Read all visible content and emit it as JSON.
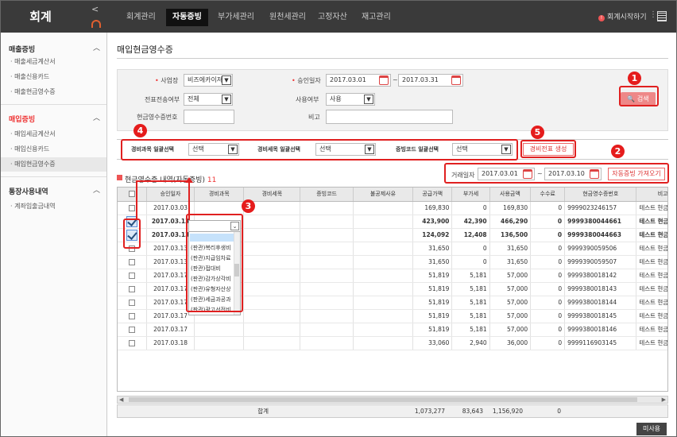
{
  "app": {
    "brand": "회계",
    "collapse": "<"
  },
  "topnav": [
    "회계관리",
    "자동증빙",
    "부가세관리",
    "원천세관리",
    "고정자산",
    "재고관리"
  ],
  "topnav_active": 1,
  "header_right": {
    "start_label": "회계시작하기",
    "kebab": "⋮"
  },
  "sidebar": {
    "groups": [
      {
        "title": "매출증빙",
        "items": [
          "매출세금계산서",
          "매출신용카드",
          "매출현금영수증"
        ]
      },
      {
        "title": "매입증빙",
        "items": [
          "매입세금계산서",
          "매입신용카드",
          "매입현금영수증"
        ]
      },
      {
        "title": "통장사용내역",
        "items": [
          "계좌입출금내역"
        ]
      }
    ],
    "active_group": 1,
    "active_item": "매입현금영수증"
  },
  "page_title": "매입현금영수증",
  "search": {
    "business_label": "사업장",
    "business_value": "비즈에카이저",
    "approval_date_label": "승인일자",
    "date_from": "2017.03.01",
    "date_to": "2017.03.31",
    "date_sep": "~",
    "voucher_sent_label": "전표전송여부",
    "voucher_sent_value": "전체",
    "usage_label": "사용여부",
    "usage_value": "사용",
    "receipt_no_label": "현금영수증번호",
    "note_label": "비고",
    "search_button": "검색"
  },
  "bulk": {
    "account_label": "경비과목 일괄선택",
    "account_value": "선택",
    "detail_label": "경비세목 일괄선택",
    "detail_value": "선택",
    "code_label": "증빙코드 일괄선택",
    "code_value": "선택",
    "generate_button": "경비전표 생성"
  },
  "list": {
    "title": "현금영수증 내역(자동증빙)",
    "count": "11",
    "trade_date_label": "거래일자",
    "trade_from": "2017.03.01",
    "trade_to": "2017.03.10",
    "fetch_button": "자동증빙 가져오기"
  },
  "table": {
    "columns": [
      "",
      "승인일자",
      "경비과목",
      "경비세목",
      "증빙코드",
      "불공제사유",
      "공급가액",
      "부가세",
      "사용금액",
      "수수료",
      "현금영수증번호",
      "비고"
    ],
    "rows": [
      {
        "checked": false,
        "bold": false,
        "date": "2017.03.03",
        "supply": "169,830",
        "vat": "0",
        "amount": "169,830",
        "fee": "0",
        "receipt": "9999023246157",
        "note": "테스트 현금영수"
      },
      {
        "checked": true,
        "bold": true,
        "date": "2017.03.13",
        "supply": "423,900",
        "vat": "42,390",
        "amount": "466,290",
        "fee": "0",
        "receipt": "9999380044661",
        "note": "테스트 현금영수"
      },
      {
        "checked": true,
        "bold": true,
        "date": "2017.03.13",
        "supply": "124,092",
        "vat": "12,408",
        "amount": "136,500",
        "fee": "0",
        "receipt": "9999380044663",
        "note": "테스트 현금영수"
      },
      {
        "checked": false,
        "bold": false,
        "date": "2017.03.13",
        "supply": "31,650",
        "vat": "0",
        "amount": "31,650",
        "fee": "0",
        "receipt": "9999390059506",
        "note": "테스트 현금영수"
      },
      {
        "checked": false,
        "bold": false,
        "date": "2017.03.13",
        "supply": "31,650",
        "vat": "0",
        "amount": "31,650",
        "fee": "0",
        "receipt": "9999390059507",
        "note": "테스트 현금영수"
      },
      {
        "checked": false,
        "bold": false,
        "date": "2017.03.17",
        "supply": "51,819",
        "vat": "5,181",
        "amount": "57,000",
        "fee": "0",
        "receipt": "9999380018142",
        "note": "테스트 현금영수"
      },
      {
        "checked": false,
        "bold": false,
        "date": "2017.03.17",
        "supply": "51,819",
        "vat": "5,181",
        "amount": "57,000",
        "fee": "0",
        "receipt": "9999380018143",
        "note": "테스트 현금영수"
      },
      {
        "checked": false,
        "bold": false,
        "date": "2017.03.17",
        "supply": "51,819",
        "vat": "5,181",
        "amount": "57,000",
        "fee": "0",
        "receipt": "9999380018144",
        "note": "테스트 현금영수"
      },
      {
        "checked": false,
        "bold": false,
        "date": "2017.03.17",
        "supply": "51,819",
        "vat": "5,181",
        "amount": "57,000",
        "fee": "0",
        "receipt": "9999380018145",
        "note": "테스트 현금영수"
      },
      {
        "checked": false,
        "bold": false,
        "date": "2017.03.17",
        "supply": "51,819",
        "vat": "5,181",
        "amount": "57,000",
        "fee": "0",
        "receipt": "9999380018146",
        "note": "테스트 현금영수"
      },
      {
        "checked": false,
        "bold": false,
        "date": "2017.03.18",
        "supply": "33,060",
        "vat": "2,940",
        "amount": "36,000",
        "fee": "0",
        "receipt": "9999116903145",
        "note": "테스트 현금영수"
      }
    ],
    "total_label": "합계",
    "total_supply": "1,073,277",
    "total_vat": "83,643",
    "total_amount": "1,156,920",
    "total_fee": "0"
  },
  "dropdown_options": [
    "(판관)복리후생비",
    "(판관)지급임차료",
    "(판관)접대비",
    "(판관)감가상각비",
    "(판관)유형자산상",
    "(판관)세금과공과",
    "(판관)광고선전비"
  ],
  "unused_button": "미사용",
  "badges": [
    "1",
    "2",
    "3",
    "4",
    "5"
  ],
  "colors": {
    "accent": "#e51c1c",
    "topbar": "#3a3a3a"
  }
}
